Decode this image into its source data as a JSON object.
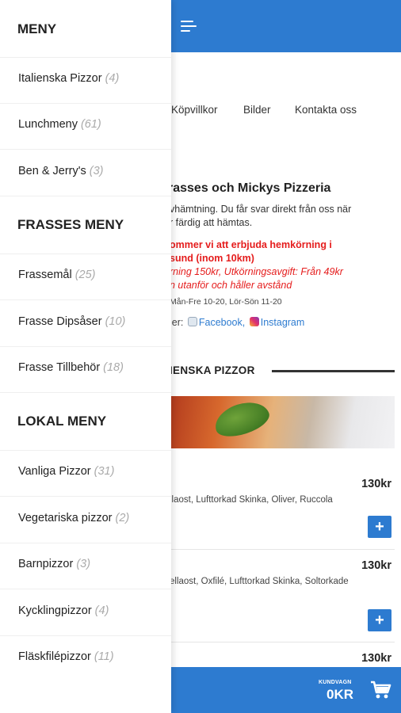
{
  "colors": {
    "brand": "#2d7bd0",
    "alert": "#e51c1c",
    "muted": "#aaaaaa"
  },
  "nav": {
    "links": [
      "Köpvillkor",
      "Bilder",
      "Kontakta oss"
    ]
  },
  "main": {
    "title": "rasses och Mickys Pizzeria",
    "desc_line1": "vhämtning. Du får svar direkt från oss när",
    "desc_line2": "r färdig att hämtas.",
    "delivery_line1": "ommer vi att erbjuda hemkörning i",
    "delivery_line2": "sund (inom 10km)",
    "delivery_line3": "rning 150kr, Utkörningsavgift: Från 49kr",
    "delivery_line4": "n utanför och håller avstånd",
    "hours": "Mån-Fre 10-20, Lör-Sön 11-20",
    "social_prefix": "ler:",
    "facebook_label": "Facebook,",
    "instagram_label": "Instagram",
    "section_heading": "IENSKA PIZZOR",
    "items": [
      {
        "price": "130kr",
        "desc": "llaost, Lufttorkad Skinka, Oliver, Ruccola",
        "add": "+"
      },
      {
        "price": "130kr",
        "desc": "ellaost, Oxfilé, Lufttorkad Skinka, Soltorkade",
        "add": "+"
      },
      {
        "price": "130kr"
      }
    ]
  },
  "cart": {
    "label": "KUNDVAGN",
    "amount": "0KR",
    "icon": "cart-icon"
  },
  "drawer": {
    "groups": [
      {
        "heading": "MENY",
        "items": [
          {
            "label": "Italienska Pizzor",
            "count": "(4)"
          },
          {
            "label": "Lunchmeny",
            "count": "(61)"
          },
          {
            "label": "Ben & Jerry's",
            "count": "(3)"
          }
        ]
      },
      {
        "heading": "FRASSES MENY",
        "items": [
          {
            "label": "Frassemål",
            "count": "(25)"
          },
          {
            "label": "Frasse Dipsåser",
            "count": "(10)"
          },
          {
            "label": "Frasse Tillbehör",
            "count": "(18)"
          }
        ]
      },
      {
        "heading": "LOKAL MENY",
        "items": [
          {
            "label": "Vanliga Pizzor",
            "count": "(31)"
          },
          {
            "label": "Vegetariska pizzor",
            "count": "(2)"
          },
          {
            "label": "Barnpizzor",
            "count": "(3)"
          },
          {
            "label": "Kycklingpizzor",
            "count": "(4)"
          },
          {
            "label": "Fläskfilépizzor",
            "count": "(11)"
          }
        ]
      }
    ]
  }
}
